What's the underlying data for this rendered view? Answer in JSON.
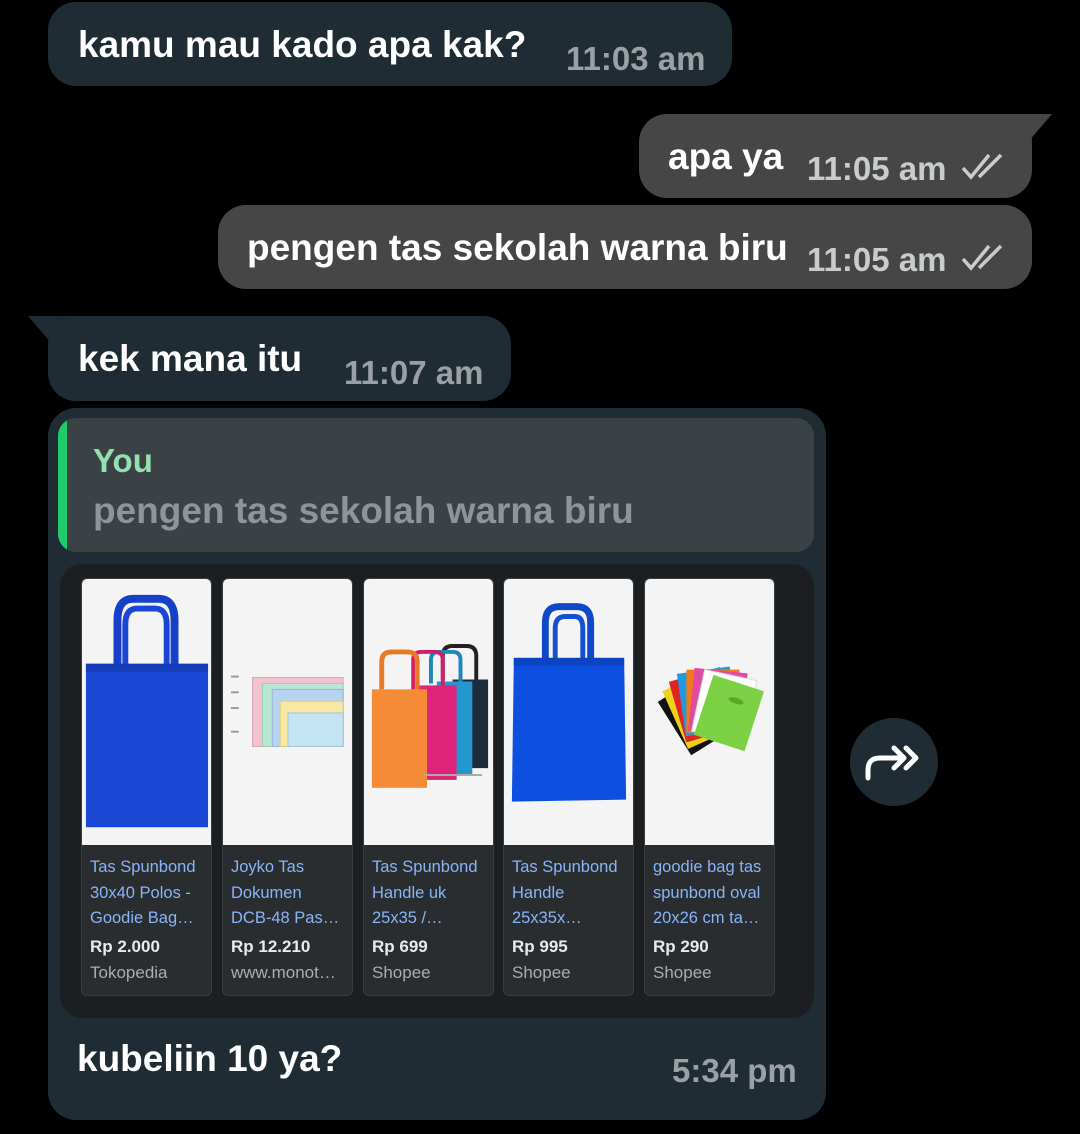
{
  "messages": [
    {
      "text": "kamu mau kado apa kak?",
      "time": "11:03 am",
      "direction": "incoming"
    },
    {
      "text": "apa ya",
      "time": "11:05 am",
      "direction": "outgoing"
    },
    {
      "text": "pengen tas sekolah warna biru",
      "time": "11:05 am",
      "direction": "outgoing"
    },
    {
      "text": "kek mana itu",
      "time": "11:07 am",
      "direction": "incoming"
    }
  ],
  "reply": {
    "quote_author": "You",
    "quote_text": "pengen tas sekolah warna biru",
    "text": "kubeliin 10 ya?",
    "time": "5:34 pm"
  },
  "products": [
    {
      "title_lines": [
        "Tas Spunbond",
        "30x40 Polos -",
        "Goodie Bag…"
      ],
      "price": "Rp 2.000",
      "store": "Tokopedia",
      "image": "blue-tote-bag"
    },
    {
      "title_lines": [
        "Joyko Tas",
        "Dokumen",
        "DCB-48 Pas…"
      ],
      "price": "Rp 12.210",
      "store": "www.monot…",
      "image": "document-pouches"
    },
    {
      "title_lines": [
        "Tas Spunbond",
        "Handle uk",
        "25x35 /…"
      ],
      "price": "Rp 699",
      "store": "Shopee",
      "image": "colorful-tote-bags"
    },
    {
      "title_lines": [
        "Tas Spunbond",
        "Handle",
        "25x35x…"
      ],
      "price": "Rp 995",
      "store": "Shopee",
      "image": "blue-tote-bag"
    },
    {
      "title_lines": [
        "goodie bag tas",
        "spunbond oval",
        "20x26 cm ta…"
      ],
      "price": "Rp 290",
      "store": "Shopee",
      "image": "colorful-die-cut-bags"
    }
  ],
  "colors": {
    "background": "#000000",
    "incoming_bubble": "#1f2c33",
    "outgoing_bubble": "#464646",
    "quote_accent": "#1fcb6b",
    "product_title": "#8ab4f8"
  },
  "icons": {
    "forward": "forward-icon",
    "read_receipt": "double-check-icon"
  }
}
